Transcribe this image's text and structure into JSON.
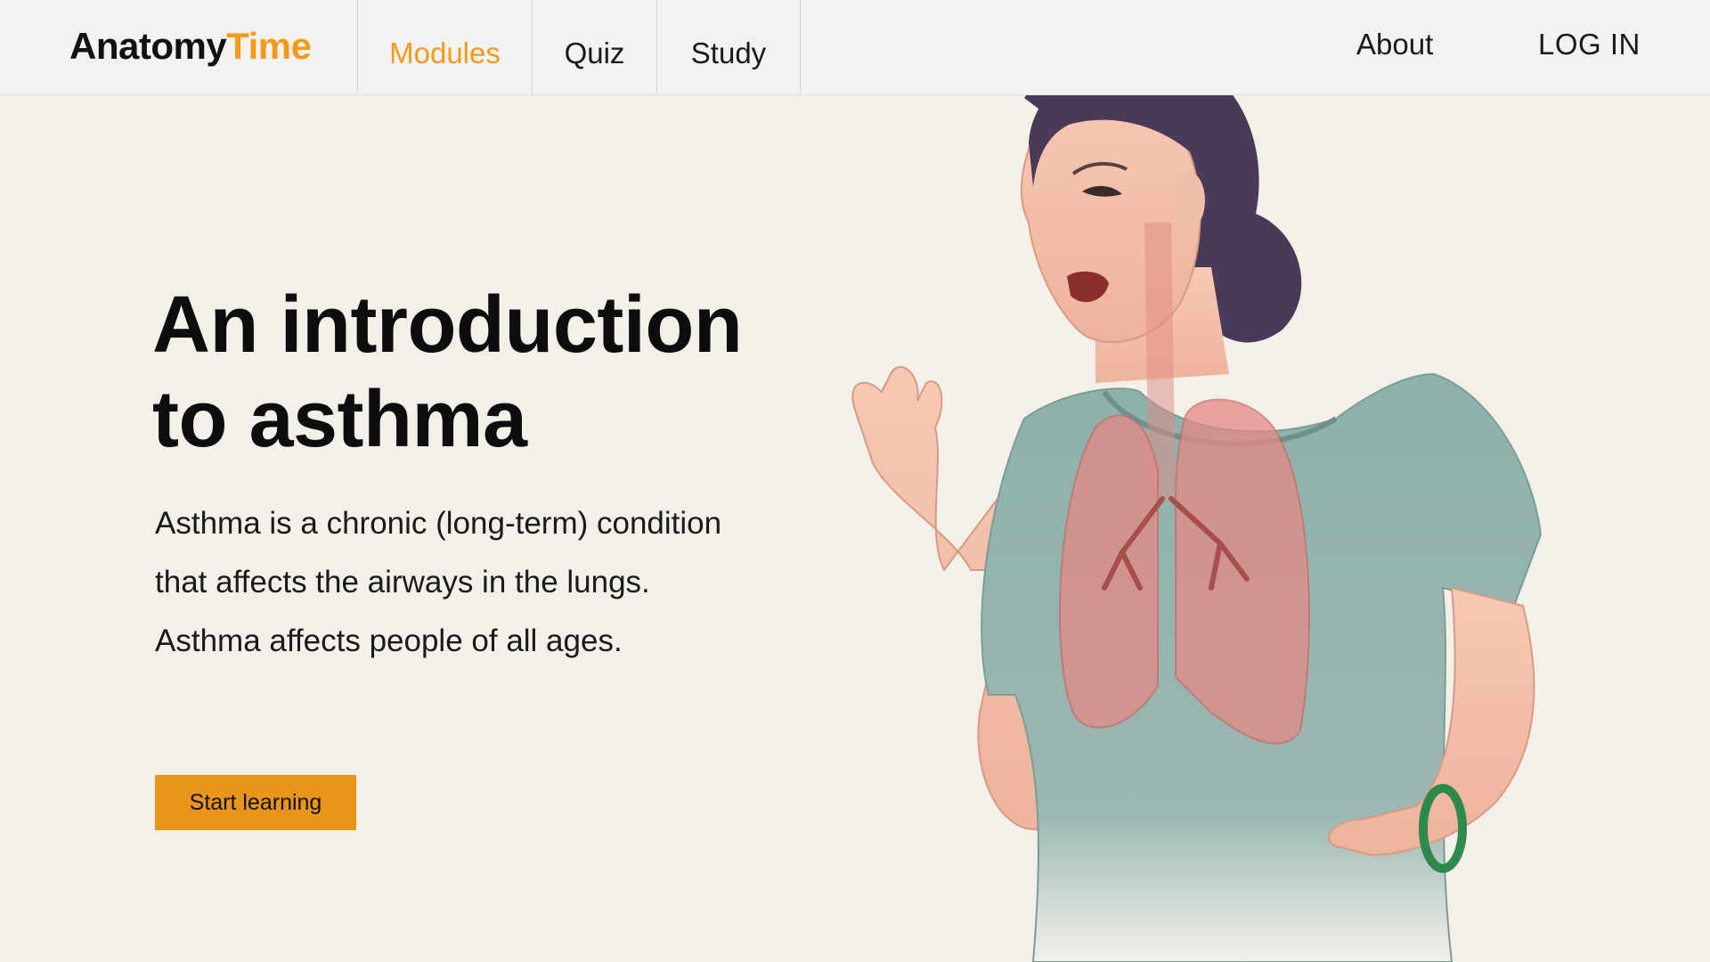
{
  "brand": {
    "name_part1": "Anatomy",
    "name_part2": "Time",
    "accent_color": "#f29a1a"
  },
  "nav": {
    "tabs": [
      {
        "label": "Modules",
        "active": true
      },
      {
        "label": "Quiz",
        "active": false
      },
      {
        "label": "Study",
        "active": false
      }
    ],
    "about": "About",
    "login": "LOG IN"
  },
  "hero": {
    "title_line1": "An introduction",
    "title_line2": "to asthma",
    "desc_line1": "Asthma is a chronic (long-term) condition",
    "desc_line2": "that affects the airways in the lungs.",
    "desc_line3": "Asthma affects people of all ages.",
    "cta_label": "Start learning",
    "cta_color": "#e9951c"
  },
  "illustration": {
    "icon": "woman-with-lungs-illustration"
  }
}
